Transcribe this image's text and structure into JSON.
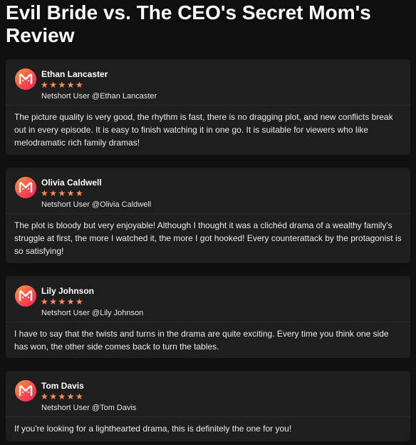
{
  "page": {
    "title": "Evil Bride vs. The CEO's Secret Mom's Review"
  },
  "colors": {
    "background": "#0f0f0f",
    "card": "#1e1e1e",
    "star": "#ff8a5c",
    "avatar_gradient": [
      "#ff9a3c",
      "#e8245c"
    ]
  },
  "reviews": [
    {
      "name": "Ethan Lancaster",
      "rating": 5,
      "stars": "★★★★★",
      "handle": "Netshort User @Ethan Lancaster",
      "text": "The picture quality is very good, the rhythm is fast, there is no dragging plot, and new conflicts break out in every episode. It is easy to finish watching it in one go. It is suitable for viewers who like melodramatic rich family dramas!"
    },
    {
      "name": "Olivia Caldwell",
      "rating": 5,
      "stars": "★★★★★",
      "handle": "Netshort User @Olivia Caldwell",
      "text": "The plot is bloody but very enjoyable! Although I thought it was a clichéd drama of a wealthy family's struggle at first, the more I watched it, the more I got hooked! Every counterattack by the protagonist is so satisfying!"
    },
    {
      "name": "Lily Johnson",
      "rating": 5,
      "stars": "★★★★★",
      "handle": "Netshort User @Lily Johnson",
      "text": "I have to say that the twists and turns in the drama are quite exciting. Every time you think one side has won, the other side comes back to turn the tables."
    },
    {
      "name": "Tom Davis",
      "rating": 5,
      "stars": "★★★★★",
      "handle": "Netshort User @Tom Davis",
      "text": "If you're looking for a lighthearted drama, this is definitely the one for you!"
    }
  ]
}
